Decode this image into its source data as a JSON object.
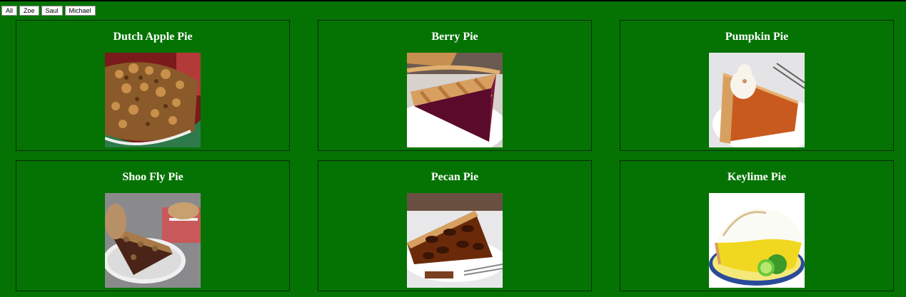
{
  "filters": [
    "All",
    "Zoe",
    "Saul",
    "Michael"
  ],
  "pies": [
    {
      "name": "Dutch Apple Pie"
    },
    {
      "name": "Berry Pie"
    },
    {
      "name": "Pumpkin Pie"
    },
    {
      "name": "Shoo Fly Pie"
    },
    {
      "name": "Pecan Pie"
    },
    {
      "name": "Keylime Pie"
    }
  ]
}
